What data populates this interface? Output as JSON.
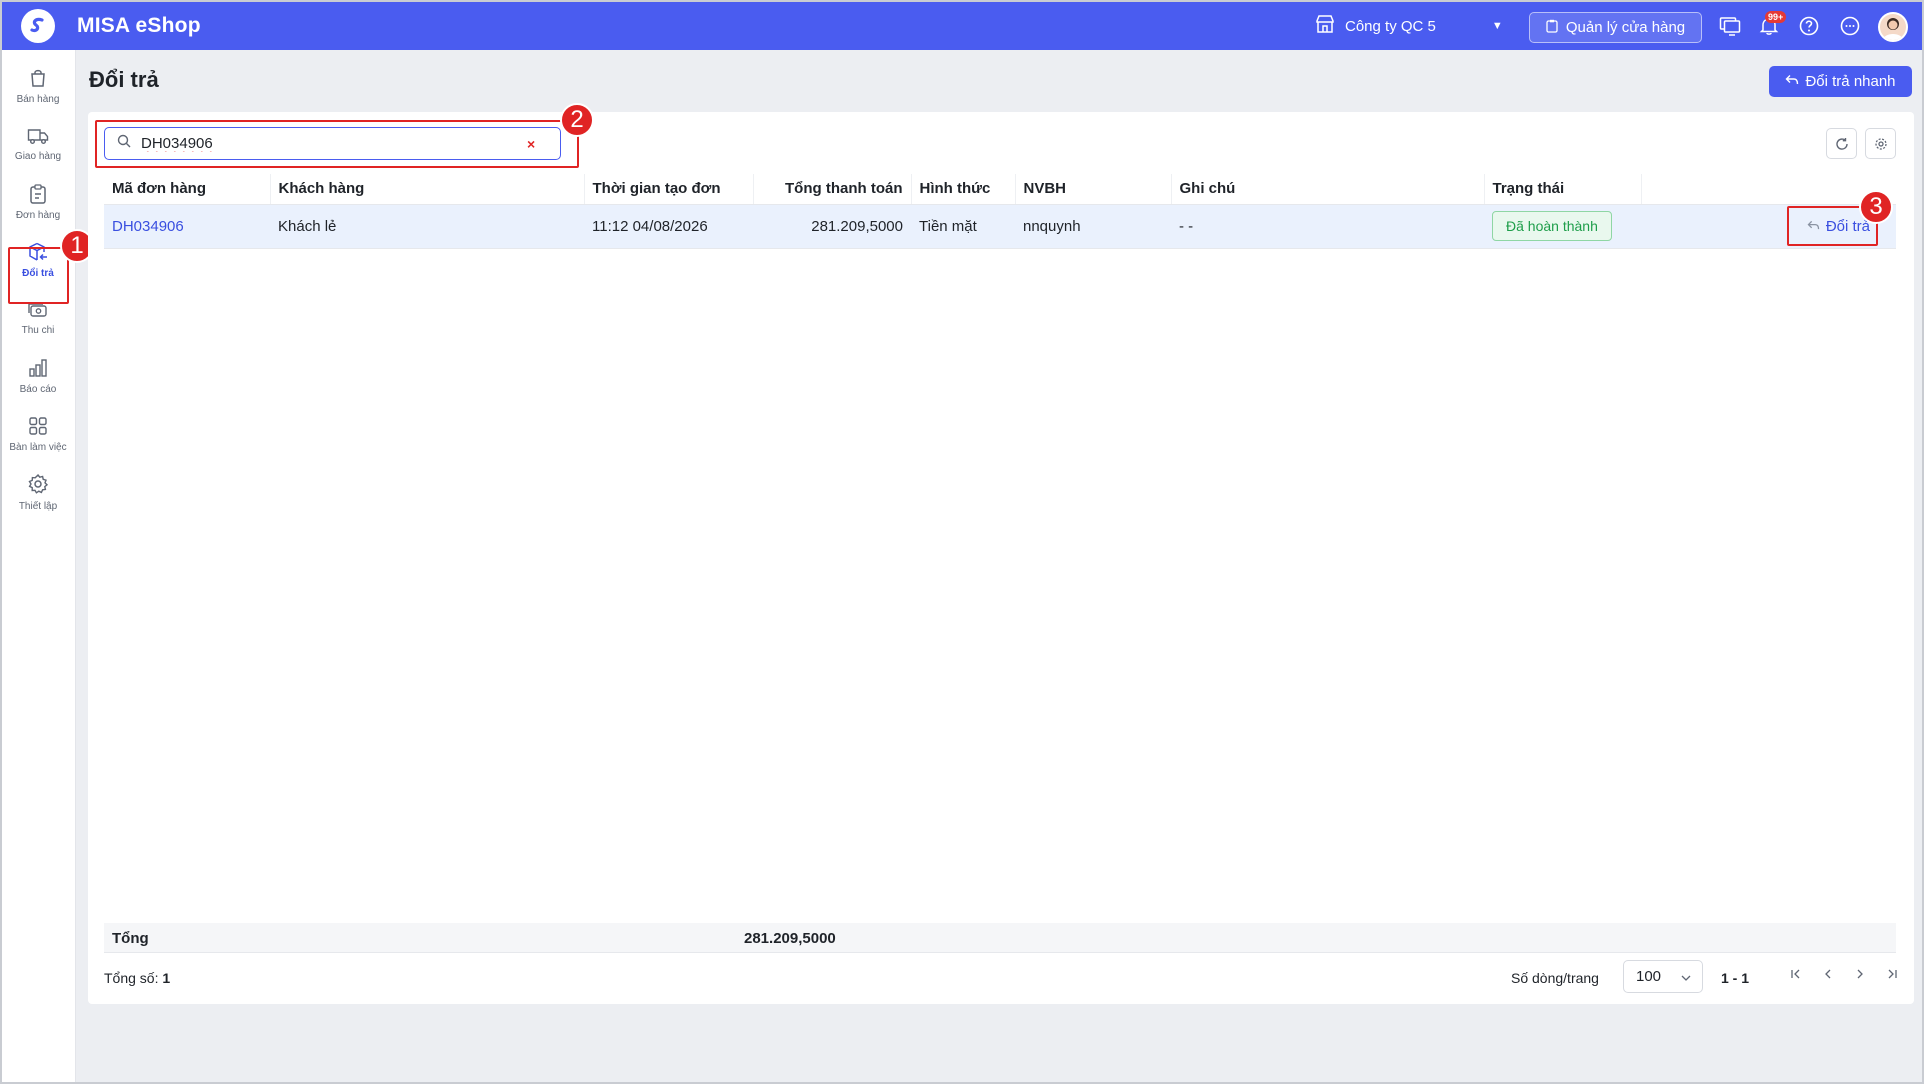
{
  "app": {
    "name": "MISA eShop"
  },
  "topbar": {
    "company": "Công ty QC 5",
    "store_button": "Quản lý cửa hàng",
    "notification_badge": "99+"
  },
  "sidebar": {
    "items": [
      {
        "label": "Bán hàng"
      },
      {
        "label": "Giao hàng"
      },
      {
        "label": "Đơn hàng"
      },
      {
        "label": "Đổi trả"
      },
      {
        "label": "Thu chi"
      },
      {
        "label": "Báo cáo"
      },
      {
        "label": "Bàn làm việc"
      },
      {
        "label": "Thiết lập"
      }
    ]
  },
  "page": {
    "title": "Đổi trả",
    "quick_button": "Đổi trả nhanh"
  },
  "search": {
    "value": "DH034906",
    "clear": "×"
  },
  "table": {
    "headers": [
      "Mã đơn hàng",
      "Khách hàng",
      "Thời gian tạo đơn",
      "Tổng thanh toán",
      "Hình thức",
      "NVBH",
      "Ghi chú",
      "Trạng thái"
    ],
    "rows": [
      {
        "order_code": "DH034906",
        "customer": "Khách lẻ",
        "created_time": "11:12 04/08/2026",
        "total": "281.209,5000",
        "payment": "Tiền mặt",
        "staff": "nnquynh",
        "note": "- -",
        "status": "Đã hoàn thành",
        "action": "Đổi trả"
      }
    ]
  },
  "totals": {
    "label": "Tổng",
    "value": "281.209,5000"
  },
  "footer": {
    "count_label": "Tổng số:",
    "count_value": "1",
    "rows_per_page_label": "Số dòng/trang",
    "rows_per_page": "100",
    "range": "1 - 1"
  },
  "annotations": [
    "1",
    "2",
    "3"
  ]
}
